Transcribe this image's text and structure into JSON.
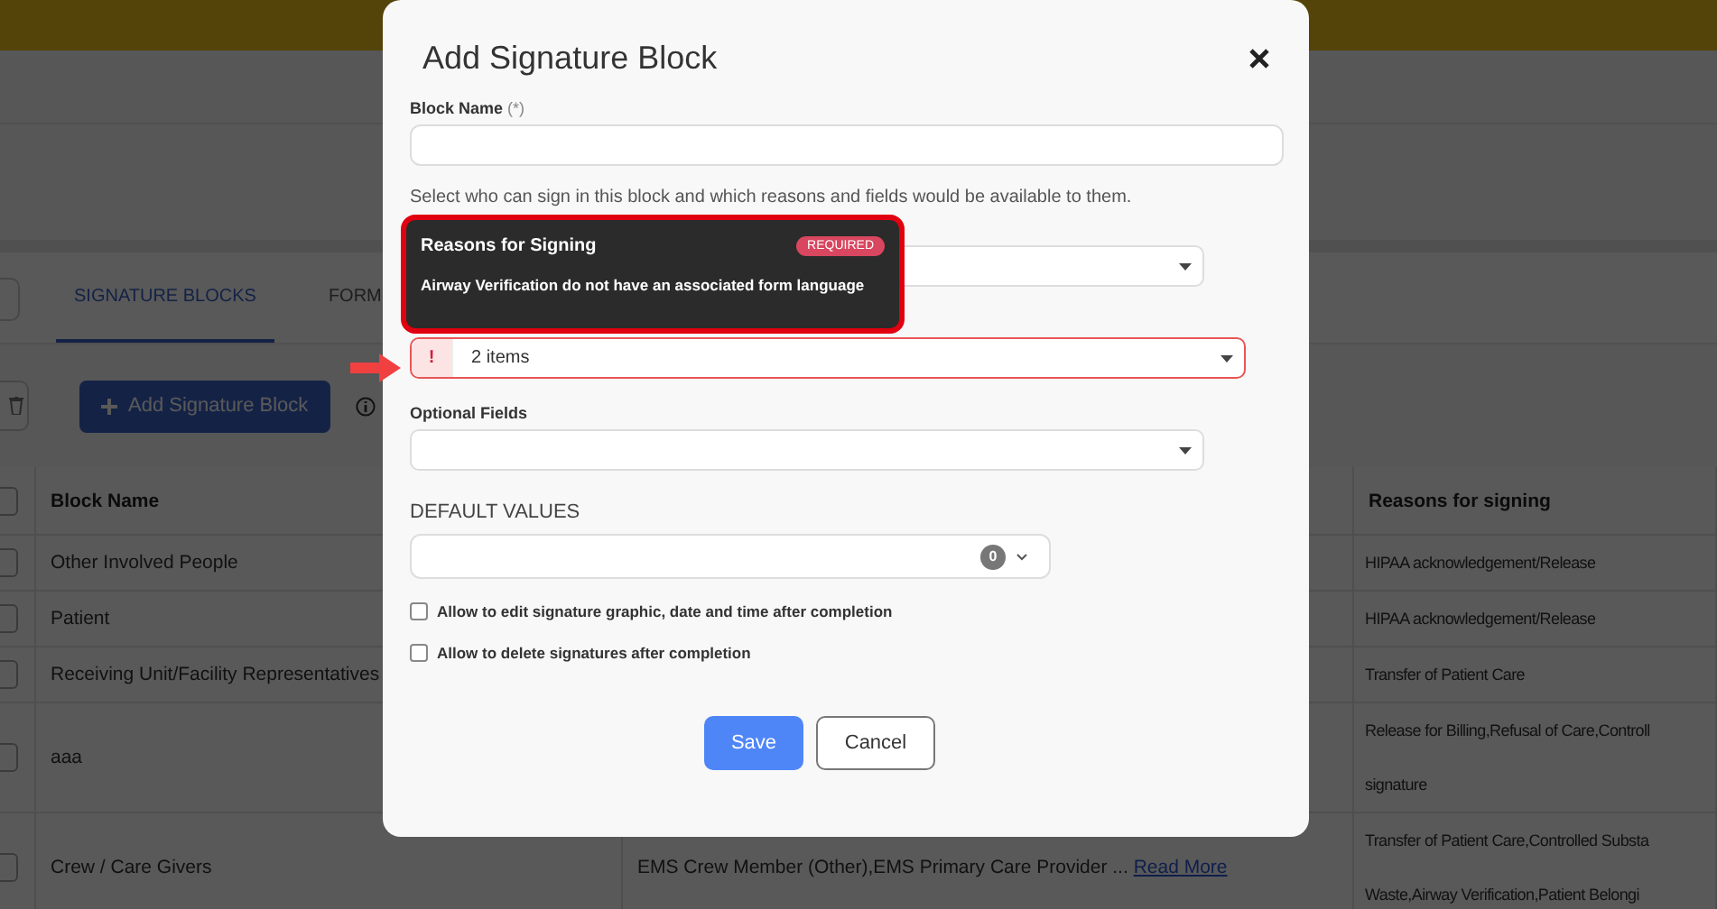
{
  "page": {
    "tabs": [
      {
        "label": "SIGNATURE BLOCKS",
        "selected": true
      },
      {
        "label": "FORM",
        "selected": false
      }
    ],
    "add_button": "Add Signature Block",
    "table": {
      "columns": [
        "Block Name",
        "Reasons for signing"
      ],
      "all_checked": false,
      "rows": [
        {
          "checked": false,
          "block_name": "Other Involved People",
          "reasons": [
            "HIPAA acknowledgement/Release"
          ]
        },
        {
          "checked": false,
          "block_name": "Patient",
          "reasons": [
            "HIPAA acknowledgement/Release"
          ]
        },
        {
          "checked": false,
          "block_name": "Receiving Unit/Facility Representatives",
          "reasons": [
            "Transfer of Patient Care"
          ]
        },
        {
          "checked": false,
          "block_name": "aaa",
          "reasons": [
            "Release for Billing,Refusal of Care,Controll",
            "signature"
          ]
        },
        {
          "checked": false,
          "block_name": "Crew / Care Givers",
          "column_2": {
            "text": "EMS Crew Member (Other),EMS Primary Care Provider ...",
            "link": "Read More"
          },
          "reasons": [
            "Transfer of Patient Care,Controlled Substa",
            "Waste,Airway Verification,Patient Belongi"
          ]
        }
      ]
    }
  },
  "dialog": {
    "title": "Add Signature Block",
    "block_name": {
      "label": "Block Name",
      "required_mark": "(*)"
    },
    "description": "Select who can sign in this block and which reasons and fields would be available to them.",
    "tooltip": {
      "title": "Reasons for Signing",
      "badge": "REQUIRED",
      "message": "Airway Verification do not have an associated form language"
    },
    "reasons_select": {
      "value": "2 items",
      "error": true,
      "error_mark": "!"
    },
    "optional_fields": {
      "label": "Optional Fields"
    },
    "default_values": {
      "label": "DEFAULT VALUES",
      "count": "0"
    },
    "checkboxes": [
      {
        "label": "Allow to edit signature graphic, date and time after completion",
        "checked": false
      },
      {
        "label": "Allow to delete signatures after completion",
        "checked": false
      }
    ],
    "buttons": [
      {
        "label": "Save",
        "kind": "primary"
      },
      {
        "label": "Cancel",
        "kind": "secondary"
      }
    ]
  }
}
